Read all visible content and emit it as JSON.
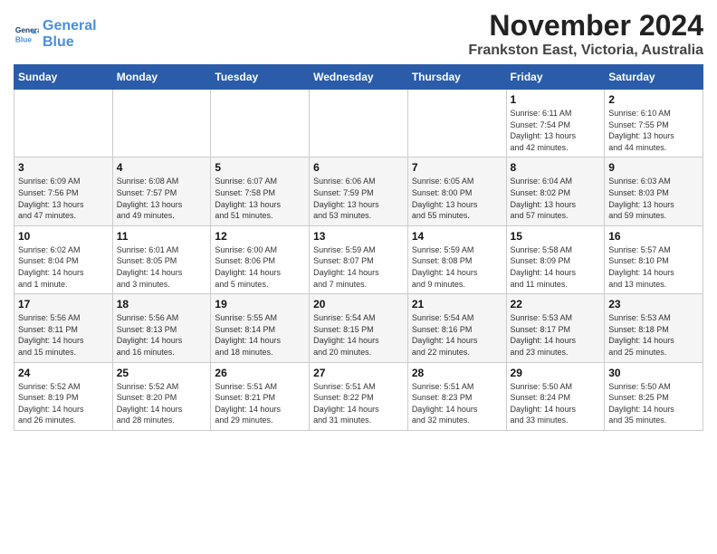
{
  "header": {
    "logo_line1": "General",
    "logo_line2": "Blue",
    "title": "November 2024",
    "subtitle": "Frankston East, Victoria, Australia"
  },
  "weekdays": [
    "Sunday",
    "Monday",
    "Tuesday",
    "Wednesday",
    "Thursday",
    "Friday",
    "Saturday"
  ],
  "weeks": [
    [
      {
        "day": "",
        "info": ""
      },
      {
        "day": "",
        "info": ""
      },
      {
        "day": "",
        "info": ""
      },
      {
        "day": "",
        "info": ""
      },
      {
        "day": "",
        "info": ""
      },
      {
        "day": "1",
        "info": "Sunrise: 6:11 AM\nSunset: 7:54 PM\nDaylight: 13 hours\nand 42 minutes."
      },
      {
        "day": "2",
        "info": "Sunrise: 6:10 AM\nSunset: 7:55 PM\nDaylight: 13 hours\nand 44 minutes."
      }
    ],
    [
      {
        "day": "3",
        "info": "Sunrise: 6:09 AM\nSunset: 7:56 PM\nDaylight: 13 hours\nand 47 minutes."
      },
      {
        "day": "4",
        "info": "Sunrise: 6:08 AM\nSunset: 7:57 PM\nDaylight: 13 hours\nand 49 minutes."
      },
      {
        "day": "5",
        "info": "Sunrise: 6:07 AM\nSunset: 7:58 PM\nDaylight: 13 hours\nand 51 minutes."
      },
      {
        "day": "6",
        "info": "Sunrise: 6:06 AM\nSunset: 7:59 PM\nDaylight: 13 hours\nand 53 minutes."
      },
      {
        "day": "7",
        "info": "Sunrise: 6:05 AM\nSunset: 8:00 PM\nDaylight: 13 hours\nand 55 minutes."
      },
      {
        "day": "8",
        "info": "Sunrise: 6:04 AM\nSunset: 8:02 PM\nDaylight: 13 hours\nand 57 minutes."
      },
      {
        "day": "9",
        "info": "Sunrise: 6:03 AM\nSunset: 8:03 PM\nDaylight: 13 hours\nand 59 minutes."
      }
    ],
    [
      {
        "day": "10",
        "info": "Sunrise: 6:02 AM\nSunset: 8:04 PM\nDaylight: 14 hours\nand 1 minute."
      },
      {
        "day": "11",
        "info": "Sunrise: 6:01 AM\nSunset: 8:05 PM\nDaylight: 14 hours\nand 3 minutes."
      },
      {
        "day": "12",
        "info": "Sunrise: 6:00 AM\nSunset: 8:06 PM\nDaylight: 14 hours\nand 5 minutes."
      },
      {
        "day": "13",
        "info": "Sunrise: 5:59 AM\nSunset: 8:07 PM\nDaylight: 14 hours\nand 7 minutes."
      },
      {
        "day": "14",
        "info": "Sunrise: 5:59 AM\nSunset: 8:08 PM\nDaylight: 14 hours\nand 9 minutes."
      },
      {
        "day": "15",
        "info": "Sunrise: 5:58 AM\nSunset: 8:09 PM\nDaylight: 14 hours\nand 11 minutes."
      },
      {
        "day": "16",
        "info": "Sunrise: 5:57 AM\nSunset: 8:10 PM\nDaylight: 14 hours\nand 13 minutes."
      }
    ],
    [
      {
        "day": "17",
        "info": "Sunrise: 5:56 AM\nSunset: 8:11 PM\nDaylight: 14 hours\nand 15 minutes."
      },
      {
        "day": "18",
        "info": "Sunrise: 5:56 AM\nSunset: 8:13 PM\nDaylight: 14 hours\nand 16 minutes."
      },
      {
        "day": "19",
        "info": "Sunrise: 5:55 AM\nSunset: 8:14 PM\nDaylight: 14 hours\nand 18 minutes."
      },
      {
        "day": "20",
        "info": "Sunrise: 5:54 AM\nSunset: 8:15 PM\nDaylight: 14 hours\nand 20 minutes."
      },
      {
        "day": "21",
        "info": "Sunrise: 5:54 AM\nSunset: 8:16 PM\nDaylight: 14 hours\nand 22 minutes."
      },
      {
        "day": "22",
        "info": "Sunrise: 5:53 AM\nSunset: 8:17 PM\nDaylight: 14 hours\nand 23 minutes."
      },
      {
        "day": "23",
        "info": "Sunrise: 5:53 AM\nSunset: 8:18 PM\nDaylight: 14 hours\nand 25 minutes."
      }
    ],
    [
      {
        "day": "24",
        "info": "Sunrise: 5:52 AM\nSunset: 8:19 PM\nDaylight: 14 hours\nand 26 minutes."
      },
      {
        "day": "25",
        "info": "Sunrise: 5:52 AM\nSunset: 8:20 PM\nDaylight: 14 hours\nand 28 minutes."
      },
      {
        "day": "26",
        "info": "Sunrise: 5:51 AM\nSunset: 8:21 PM\nDaylight: 14 hours\nand 29 minutes."
      },
      {
        "day": "27",
        "info": "Sunrise: 5:51 AM\nSunset: 8:22 PM\nDaylight: 14 hours\nand 31 minutes."
      },
      {
        "day": "28",
        "info": "Sunrise: 5:51 AM\nSunset: 8:23 PM\nDaylight: 14 hours\nand 32 minutes."
      },
      {
        "day": "29",
        "info": "Sunrise: 5:50 AM\nSunset: 8:24 PM\nDaylight: 14 hours\nand 33 minutes."
      },
      {
        "day": "30",
        "info": "Sunrise: 5:50 AM\nSunset: 8:25 PM\nDaylight: 14 hours\nand 35 minutes."
      }
    ]
  ]
}
